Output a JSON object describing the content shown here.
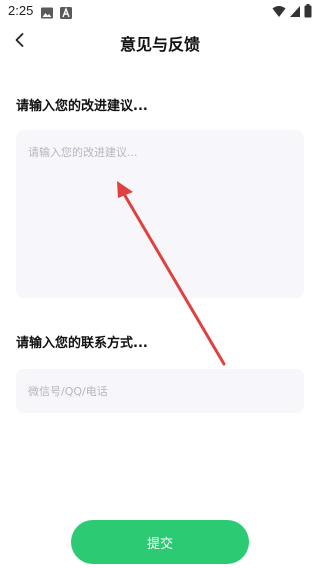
{
  "status_bar": {
    "time": "2:25",
    "left_icons": [
      "image-icon",
      "text-a-icon"
    ],
    "right_icons": [
      "wifi-icon",
      "cellular-signal-icon",
      "battery-icon"
    ]
  },
  "header": {
    "title": "意见与反馈",
    "back_icon": "chevron-left-icon"
  },
  "suggestion": {
    "label": "请输入您的改进建议...",
    "placeholder": "请输入您的改进建议...",
    "value": ""
  },
  "contact": {
    "label": "请输入您的联系方式...",
    "placeholder": "微信号/QQ/电话",
    "value": ""
  },
  "submit": {
    "label": "提交",
    "color": "#2ccb73"
  },
  "annotation": {
    "type": "arrow",
    "color": "#e0403f"
  }
}
